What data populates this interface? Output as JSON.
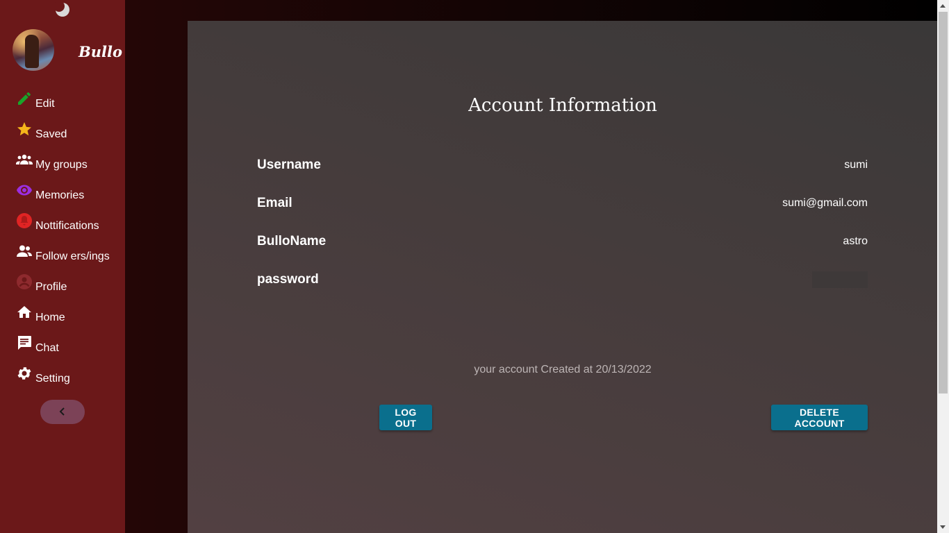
{
  "sidebar": {
    "brand": "Bullo",
    "items": [
      {
        "label": "Edit",
        "icon": "pencil-icon",
        "color": "#1aa42a"
      },
      {
        "label": "Saved",
        "icon": "star-icon",
        "color": "#f5b51b"
      },
      {
        "label": "My groups",
        "icon": "groups-icon",
        "color": "#ffffff"
      },
      {
        "label": "Memories",
        "icon": "eye-icon",
        "color": "#9b2ee0"
      },
      {
        "label": "Nottifications",
        "icon": "bell-icon",
        "color": "#e02424"
      },
      {
        "label": "Follow ers/ings",
        "icon": "people-icon",
        "color": "#ffffff"
      },
      {
        "label": "Profile",
        "icon": "account-circle-icon",
        "color": "#8e2a2e"
      },
      {
        "label": "Home",
        "icon": "home-icon",
        "color": "#ffffff"
      },
      {
        "label": "Chat",
        "icon": "chat-icon",
        "color": "#ffffff"
      },
      {
        "label": "Setting",
        "icon": "gear-icon",
        "color": "#ffffff"
      }
    ]
  },
  "panel": {
    "title": "Account Information",
    "rows": [
      {
        "label": "Username",
        "value": "sumi"
      },
      {
        "label": "Email",
        "value": "sumi@gmail.com"
      },
      {
        "label": "BulloName",
        "value": "astro"
      },
      {
        "label": "password",
        "value": ""
      }
    ],
    "created": "your account Created at 20/13/2022",
    "logout_label": "LOG OUT",
    "delete_label": "DELETE ACCOUNT"
  },
  "colors": {
    "sidebar_bg": "#6b1819",
    "button": "#0a6f8d",
    "panel_bg": "#453c3c"
  }
}
